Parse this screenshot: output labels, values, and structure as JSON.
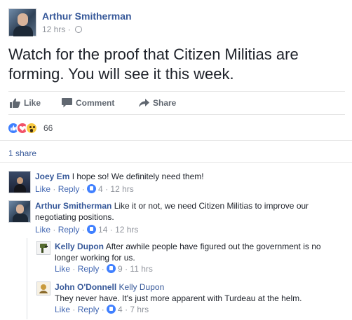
{
  "post": {
    "author": "Arthur Smitherman",
    "time": "12 hrs",
    "sep": "·",
    "text": "Watch for the proof that Citizen Militias are forming. You will see it this week."
  },
  "actions": {
    "like": "Like",
    "comment": "Comment",
    "share": "Share"
  },
  "reactions": {
    "count": "66",
    "types": [
      "like",
      "love",
      "wow"
    ]
  },
  "shares": "1 share",
  "comments": [
    {
      "name": "Joey Em",
      "text": "I hope so! We definitely need them!",
      "like": "Like",
      "reply": "Reply",
      "likes": "4",
      "time": "12 hrs"
    },
    {
      "name": "Arthur Smitherman",
      "text": "Like it or not, we need Citizen Militias to improve our negotiating positions.",
      "like": "Like",
      "reply": "Reply",
      "likes": "14",
      "time": "12 hrs"
    },
    {
      "name": "Kelly Dupon",
      "text": "After awhile people have figured out the government is no longer working for us.",
      "like": "Like",
      "reply": "Reply",
      "likes": "9",
      "time": "11 hrs"
    },
    {
      "name": "John O'Donnell",
      "tag": "Kelly Dupon",
      "text": "They never have. It's just more apparent with Turdeau at the helm.",
      "like": "Like",
      "reply": "Reply",
      "likes": "4",
      "time": "7 hrs"
    }
  ],
  "colors": {
    "link": "#365899",
    "action_link": "#4267b2",
    "meta": "#90949c",
    "like": "#4080ff",
    "love": "#f25268",
    "wow": "#f7c941"
  },
  "icons": [
    "thumbs-up-icon",
    "comment-bubble-icon",
    "share-arrow-icon",
    "globe-icon"
  ]
}
